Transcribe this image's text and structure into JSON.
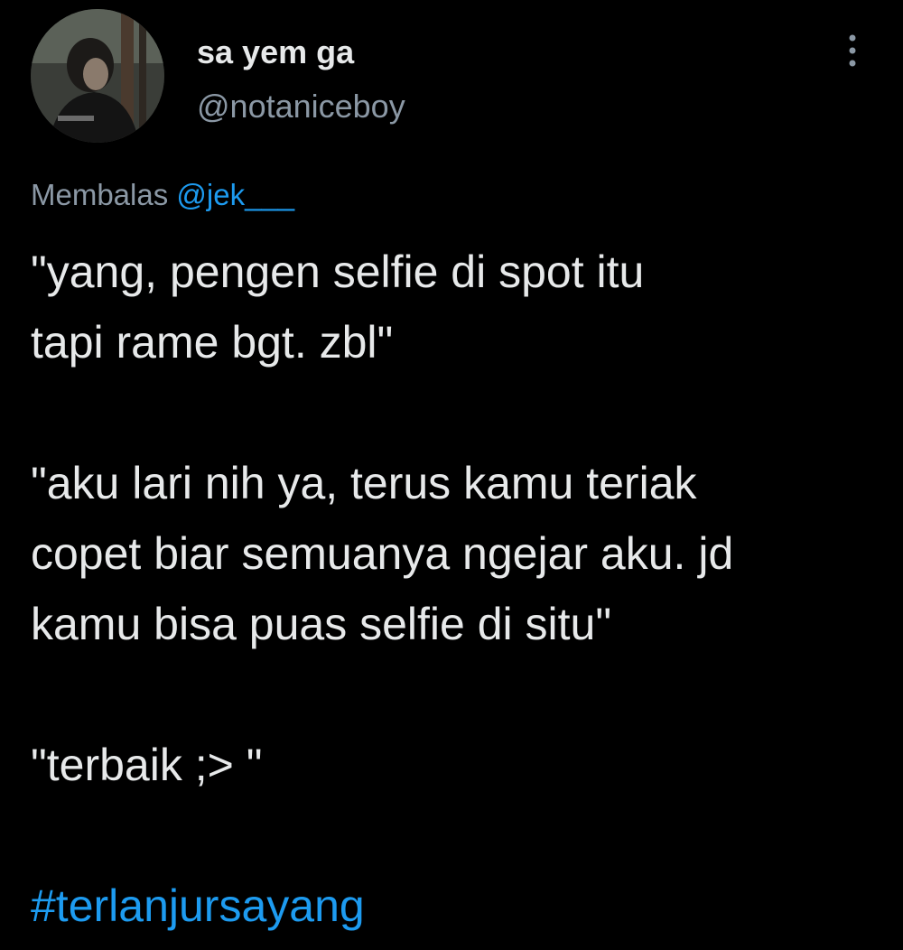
{
  "author": {
    "display_name": "sa yem ga",
    "handle": "@notaniceboy"
  },
  "reply": {
    "prefix": "Membalas",
    "mention": "@jek___"
  },
  "tweet": {
    "paragraphs": [
      [
        "\"yang, pengen selfie di spot itu",
        "tapi rame bgt. zbl\""
      ],
      [
        "\"aku lari nih ya, terus kamu teriak",
        "copet biar semuanya ngejar aku. jd",
        "kamu bisa puas selfie di situ\""
      ],
      [
        "\"terbaik ;> \""
      ]
    ],
    "hashtag": "#terlanjursayang"
  },
  "colors": {
    "background": "#000000",
    "text": "#e7e9ea",
    "secondary": "#8b98a5",
    "accent": "#1d9bf0"
  },
  "icons": {
    "more": "more-vertical-icon",
    "avatar": "profile-photo"
  }
}
